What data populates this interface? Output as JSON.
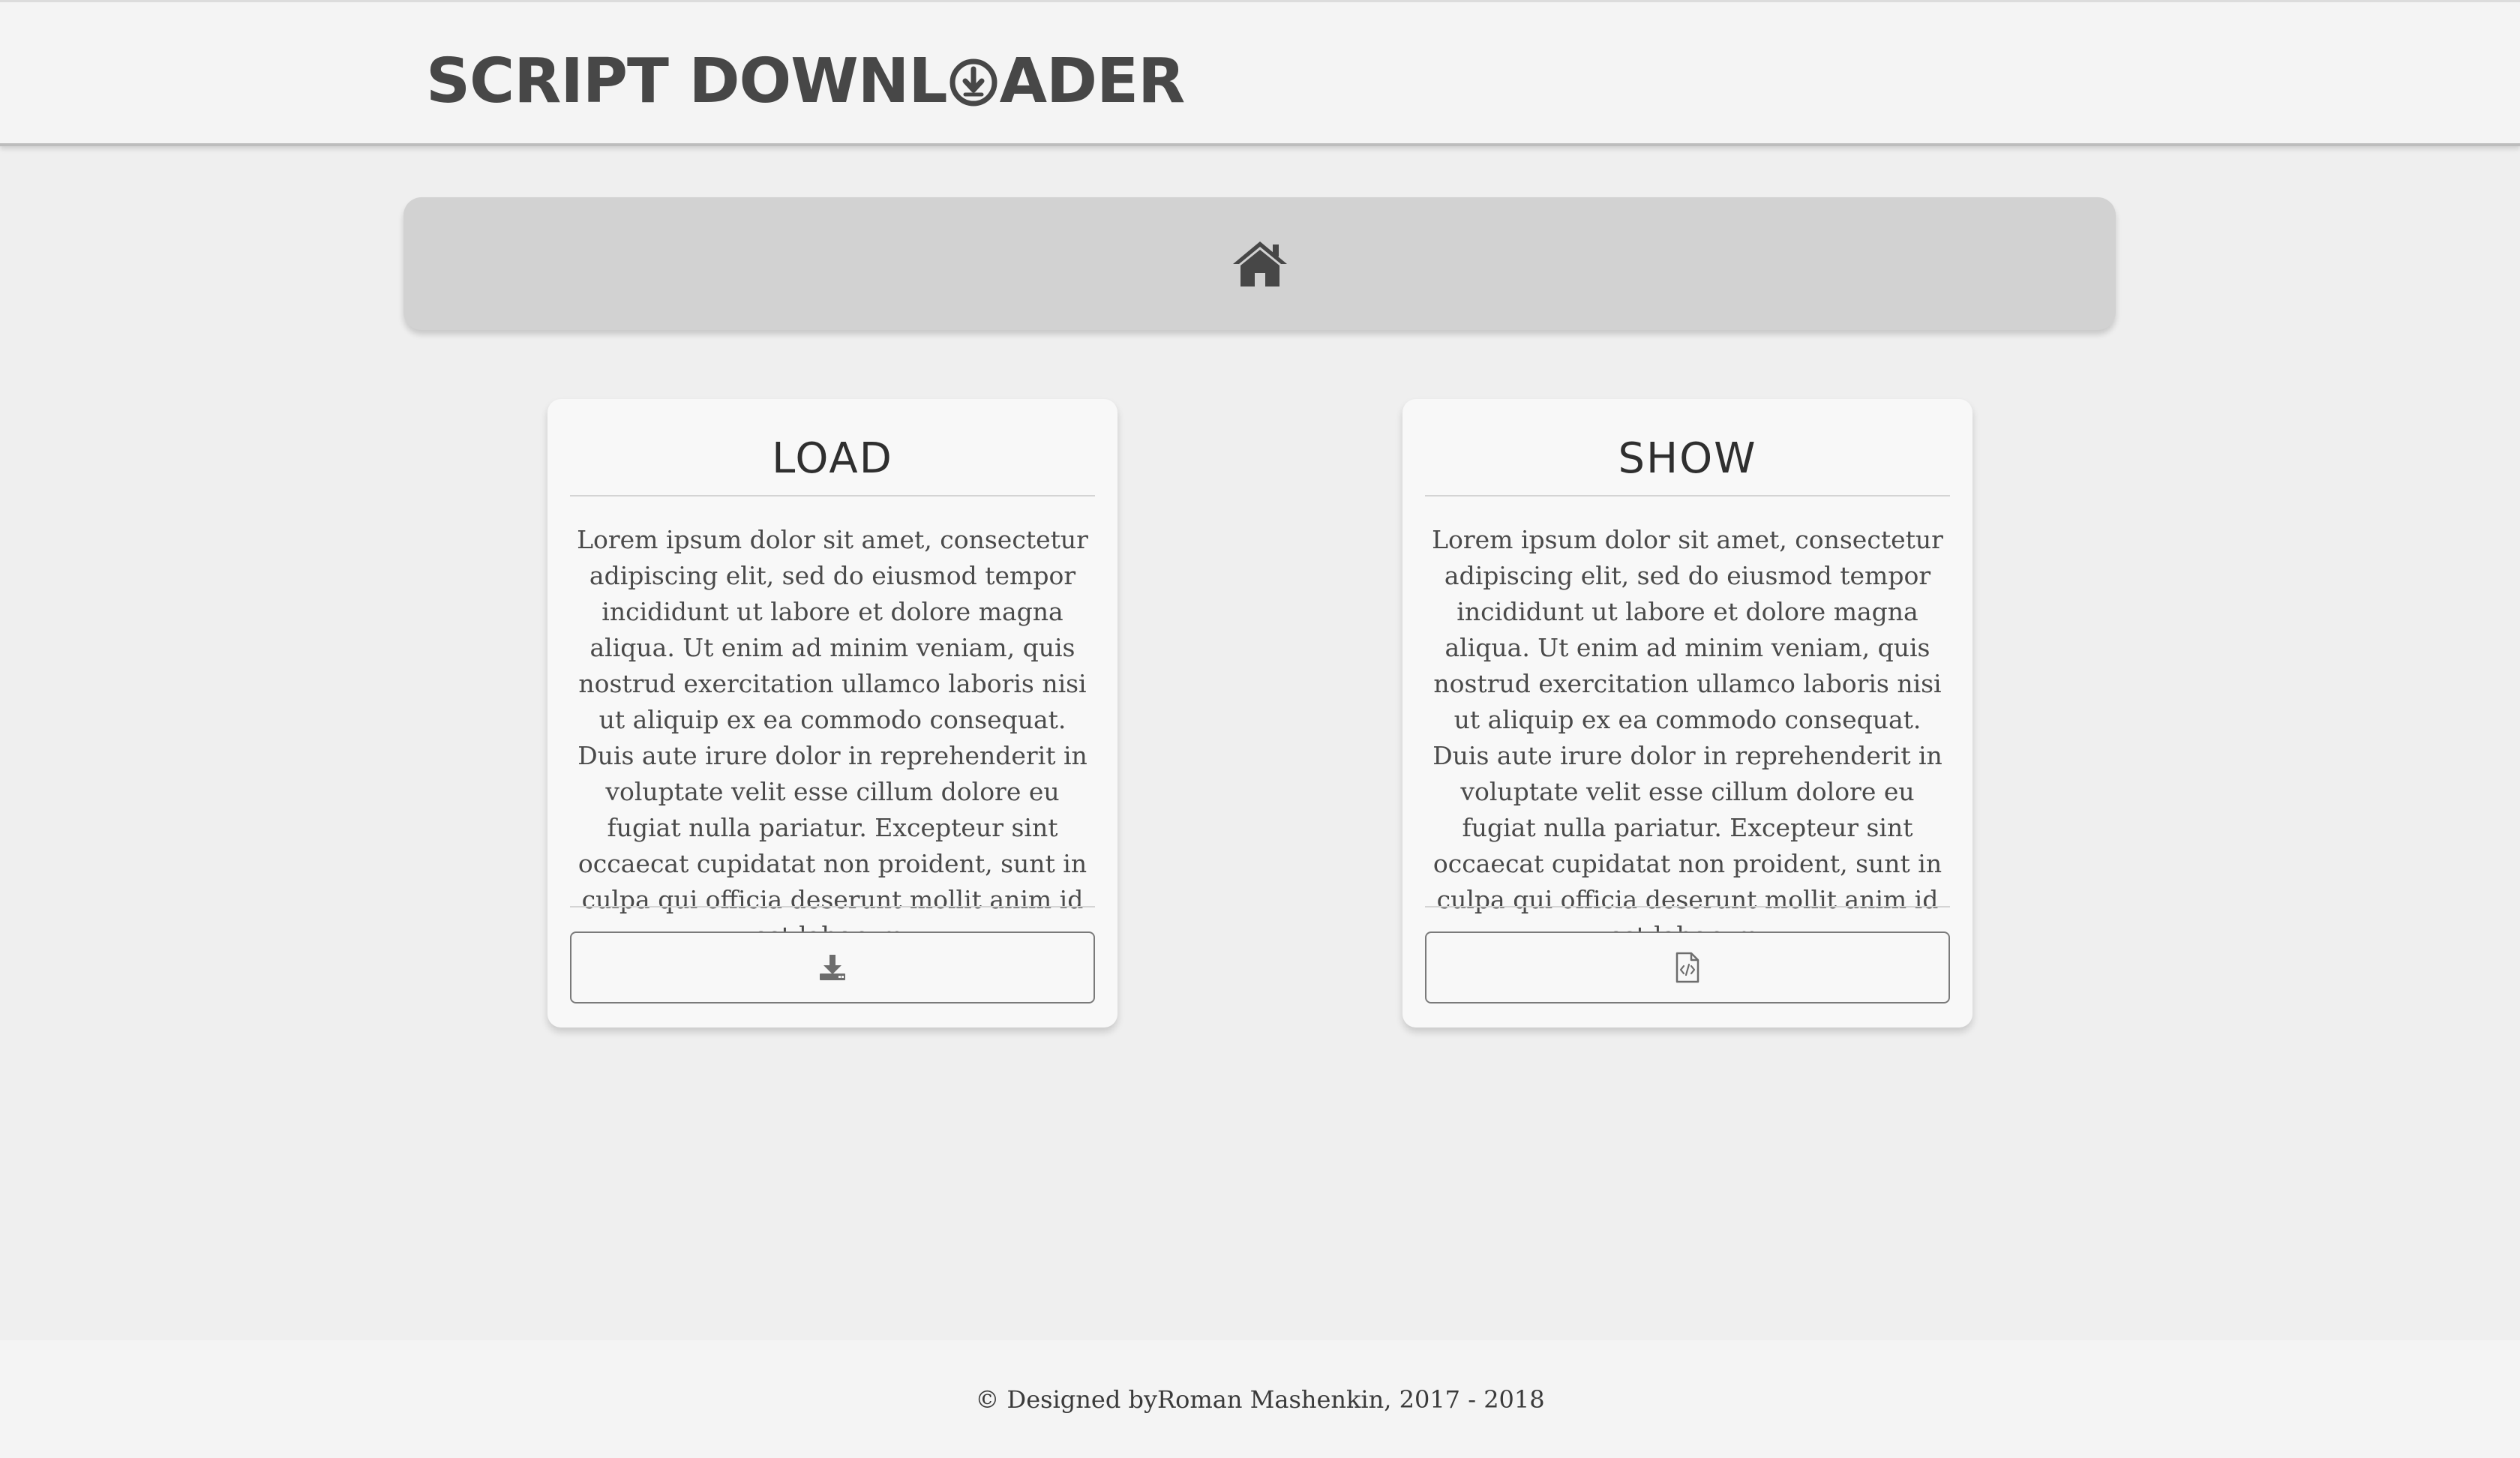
{
  "header": {
    "logo_prefix": "SCRIPT DOWNL",
    "logo_icon": "download-circle-icon",
    "logo_suffix": "ADER"
  },
  "nav": {
    "home_icon": "home-icon"
  },
  "cards": [
    {
      "title": "LOAD",
      "text": "Lorem ipsum dolor sit amet, consectetur adipiscing elit, sed do eiusmod tempor incididunt ut labore et dolore magna aliqua. Ut enim ad minim veniam, quis nostrud exercitation ullamco laboris nisi ut aliquip ex ea commodo consequat. Duis aute irure dolor in reprehenderit in voluptate velit esse cillum dolore eu fugiat nulla pariatur. Excepteur sint occaecat cupidatat non proident, sunt in culpa qui officia deserunt mollit anim id est laborum.",
      "button_icon": "download-tray-icon"
    },
    {
      "title": "SHOW",
      "text": "Lorem ipsum dolor sit amet, consectetur adipiscing elit, sed do eiusmod tempor incididunt ut labore et dolore magna aliqua. Ut enim ad minim veniam, quis nostrud exercitation ullamco laboris nisi ut aliquip ex ea commodo consequat. Duis aute irure dolor in reprehenderit in voluptate velit esse cillum dolore eu fugiat nulla pariatur. Excepteur sint occaecat cupidatat non proident, sunt in culpa qui officia deserunt mollit anim id est laborum.",
      "button_icon": "file-code-icon"
    }
  ],
  "footer": {
    "prefix": "© Designed by ",
    "author": "Roman Mashenkin",
    "suffix": ", 2017 - 2018"
  },
  "colors": {
    "background": "#efefef",
    "header_bg": "#f4f4f4",
    "navbar_bg": "#d2d2d2",
    "card_bg": "#f8f8f8",
    "text_dark": "#474747"
  }
}
